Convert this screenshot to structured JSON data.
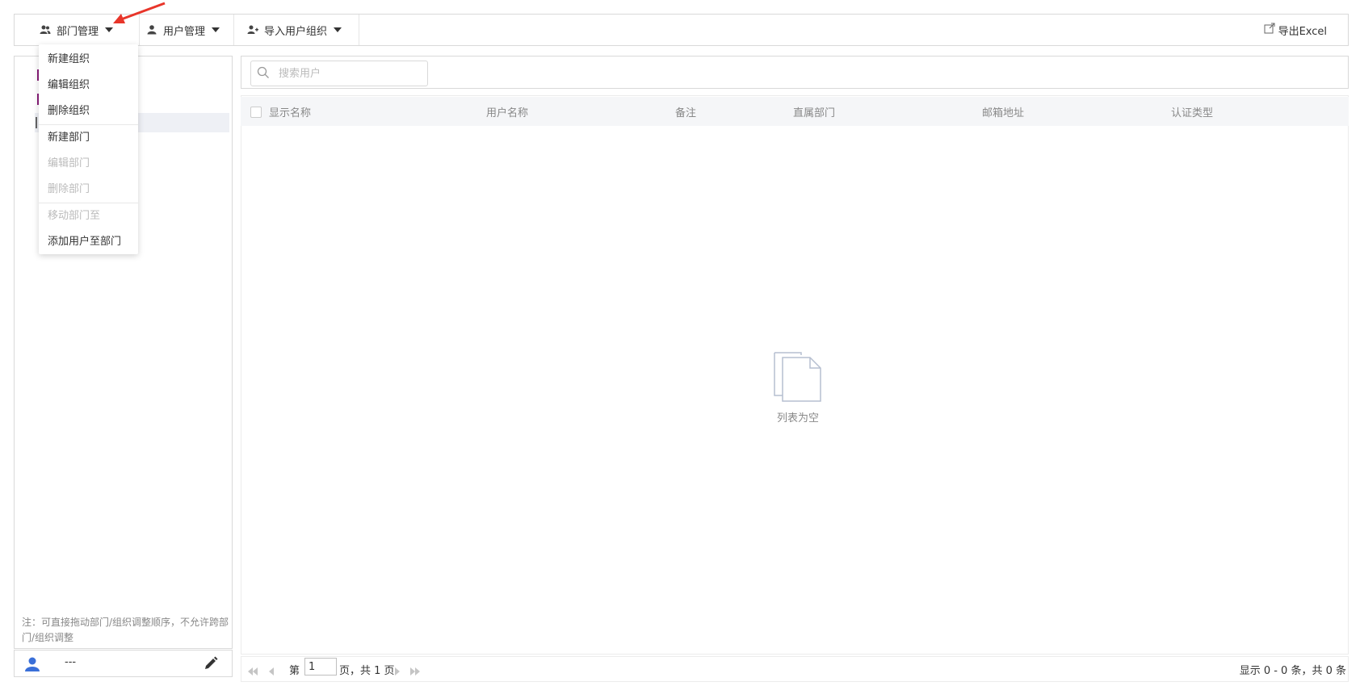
{
  "toolbar": {
    "dept_mgmt_label": "部门管理",
    "user_mgmt_label": "用户管理",
    "import_label": "导入用户组织",
    "export_label": "导出Excel"
  },
  "dropdown": {
    "items": [
      {
        "label": "新建组织",
        "enabled": true
      },
      {
        "label": "编辑组织",
        "enabled": true
      },
      {
        "label": "删除组织",
        "enabled": true
      },
      {
        "label": "新建部门",
        "enabled": true
      },
      {
        "label": "编辑部门",
        "enabled": false
      },
      {
        "label": "删除部门",
        "enabled": false
      },
      {
        "label": "移动部门至",
        "enabled": false
      },
      {
        "label": "添加用户至部门",
        "enabled": true
      }
    ]
  },
  "left_panel": {
    "note": "注：可直接拖动部门/组织调整顺序，不允许跨部门/组织调整",
    "user_name": "---"
  },
  "search": {
    "placeholder": "搜索用户"
  },
  "table": {
    "columns": [
      "显示名称",
      "用户名称",
      "备注",
      "直属部门",
      "邮箱地址",
      "认证类型"
    ],
    "rows": [],
    "empty_text": "列表为空"
  },
  "pager": {
    "page_prefix": "第",
    "current_page": "1",
    "page_suffix": "页，共 1 页",
    "record_info": "显示 0 - 0 条，共 0 条"
  },
  "colors": {
    "arrow": "#e8352a",
    "user_icon": "#3a6fd8",
    "tree_marker": "#8a1f7a"
  }
}
